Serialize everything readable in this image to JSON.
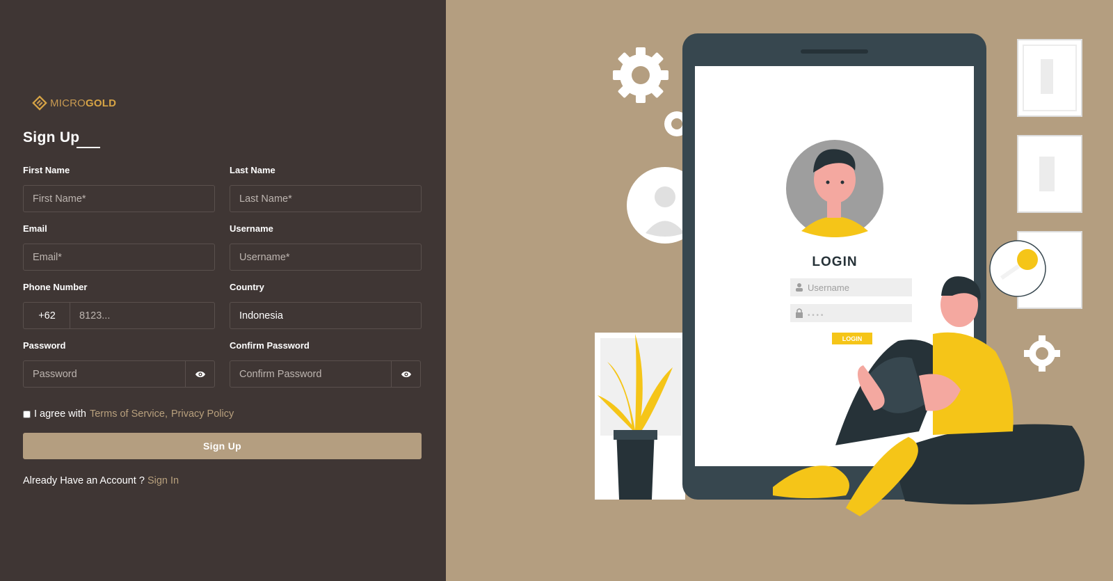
{
  "brand": {
    "name_light": "MICRO",
    "name_bold": "GOLD"
  },
  "form": {
    "title": "Sign Up",
    "first_name": {
      "label": "First Name",
      "placeholder": "First Name*"
    },
    "last_name": {
      "label": "Last Name",
      "placeholder": "Last Name*"
    },
    "email": {
      "label": "Email",
      "placeholder": "Email*"
    },
    "username": {
      "label": "Username",
      "placeholder": "Username*"
    },
    "phone": {
      "label": "Phone Number",
      "prefix": "+62",
      "placeholder": "8123..."
    },
    "country": {
      "label": "Country",
      "value": "Indonesia"
    },
    "password": {
      "label": "Password",
      "placeholder": "Password"
    },
    "confirm_password": {
      "label": "Confirm Password",
      "placeholder": "Confirm Password"
    },
    "agree": {
      "text": "I agree with",
      "terms_link": "Terms of Service",
      "separator": ",",
      "privacy_link": "Privacy Policy"
    },
    "submit_label": "Sign Up",
    "already": {
      "text": "Already Have an Account ?",
      "link": "Sign In"
    }
  },
  "illustration": {
    "heading": "LOGIN",
    "username_placeholder": "Username",
    "password_dots": "• • • •",
    "button_label": "LOGIN"
  },
  "icons": {
    "logo": "microgold-logo-mark",
    "eye": "eye-icon",
    "user": "user-icon",
    "lock": "lock-icon",
    "gear": "gear-icon",
    "key": "key-icon"
  },
  "colors": {
    "panel": "#3f3634",
    "accent": "#b49e80",
    "gold": "#d7a445",
    "illustration_yellow": "#f5c518",
    "phone_frame": "#37474f"
  }
}
